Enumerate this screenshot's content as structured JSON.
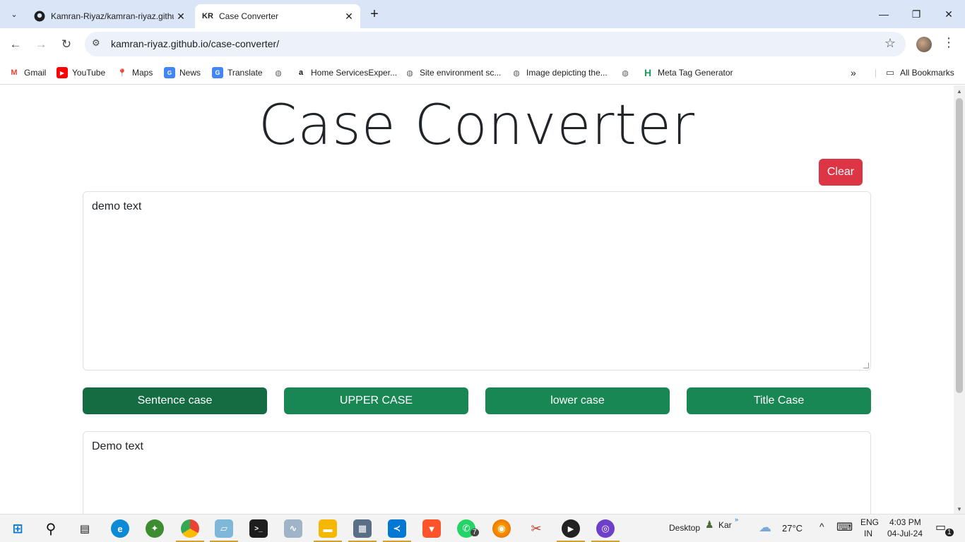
{
  "browser": {
    "tabs": [
      {
        "favicon": "github-icon",
        "title": "Kamran-Riyaz/kamran-riyaz.github.io"
      },
      {
        "favicon": "KR",
        "title": "Case Converter"
      }
    ],
    "url": "kamran-riyaz.github.io/case-converter/",
    "bookmarks": [
      {
        "label": "Gmail",
        "icon": "gmail-icon"
      },
      {
        "label": "YouTube",
        "icon": "youtube-icon"
      },
      {
        "label": "Maps",
        "icon": "maps-icon"
      },
      {
        "label": "News",
        "icon": "news-icon"
      },
      {
        "label": "Translate",
        "icon": "translate-icon"
      },
      {
        "label": "",
        "icon": "globe-icon"
      },
      {
        "label": "Home ServicesExper...",
        "icon": "amazon-icon"
      },
      {
        "label": "Site environment sc...",
        "icon": "globe-icon"
      },
      {
        "label": "Image depicting the...",
        "icon": "globe-icon"
      },
      {
        "label": "",
        "icon": "globe-icon"
      },
      {
        "label": "Meta Tag Generator",
        "icon": "h-icon"
      }
    ],
    "all_bookmarks": "All Bookmarks"
  },
  "page": {
    "title": "Case Converter",
    "clear_label": "Clear",
    "input_text": "demo text",
    "buttons": [
      "Sentence case",
      "UPPER CASE",
      "lower case",
      "Title Case"
    ],
    "output_text": "Demo text"
  },
  "taskbar": {
    "desktop_label": "Desktop",
    "user_label": "Kar",
    "weather": "27°C",
    "lang_top": "ENG",
    "lang_bottom": "IN",
    "time": "4:03 PM",
    "date": "04-Jul-24",
    "whatsapp_badge": "7",
    "notif_badge": "1"
  },
  "colors": {
    "accent_green": "#198754",
    "danger_red": "#dc3545",
    "tabstrip": "#dae6f8"
  }
}
